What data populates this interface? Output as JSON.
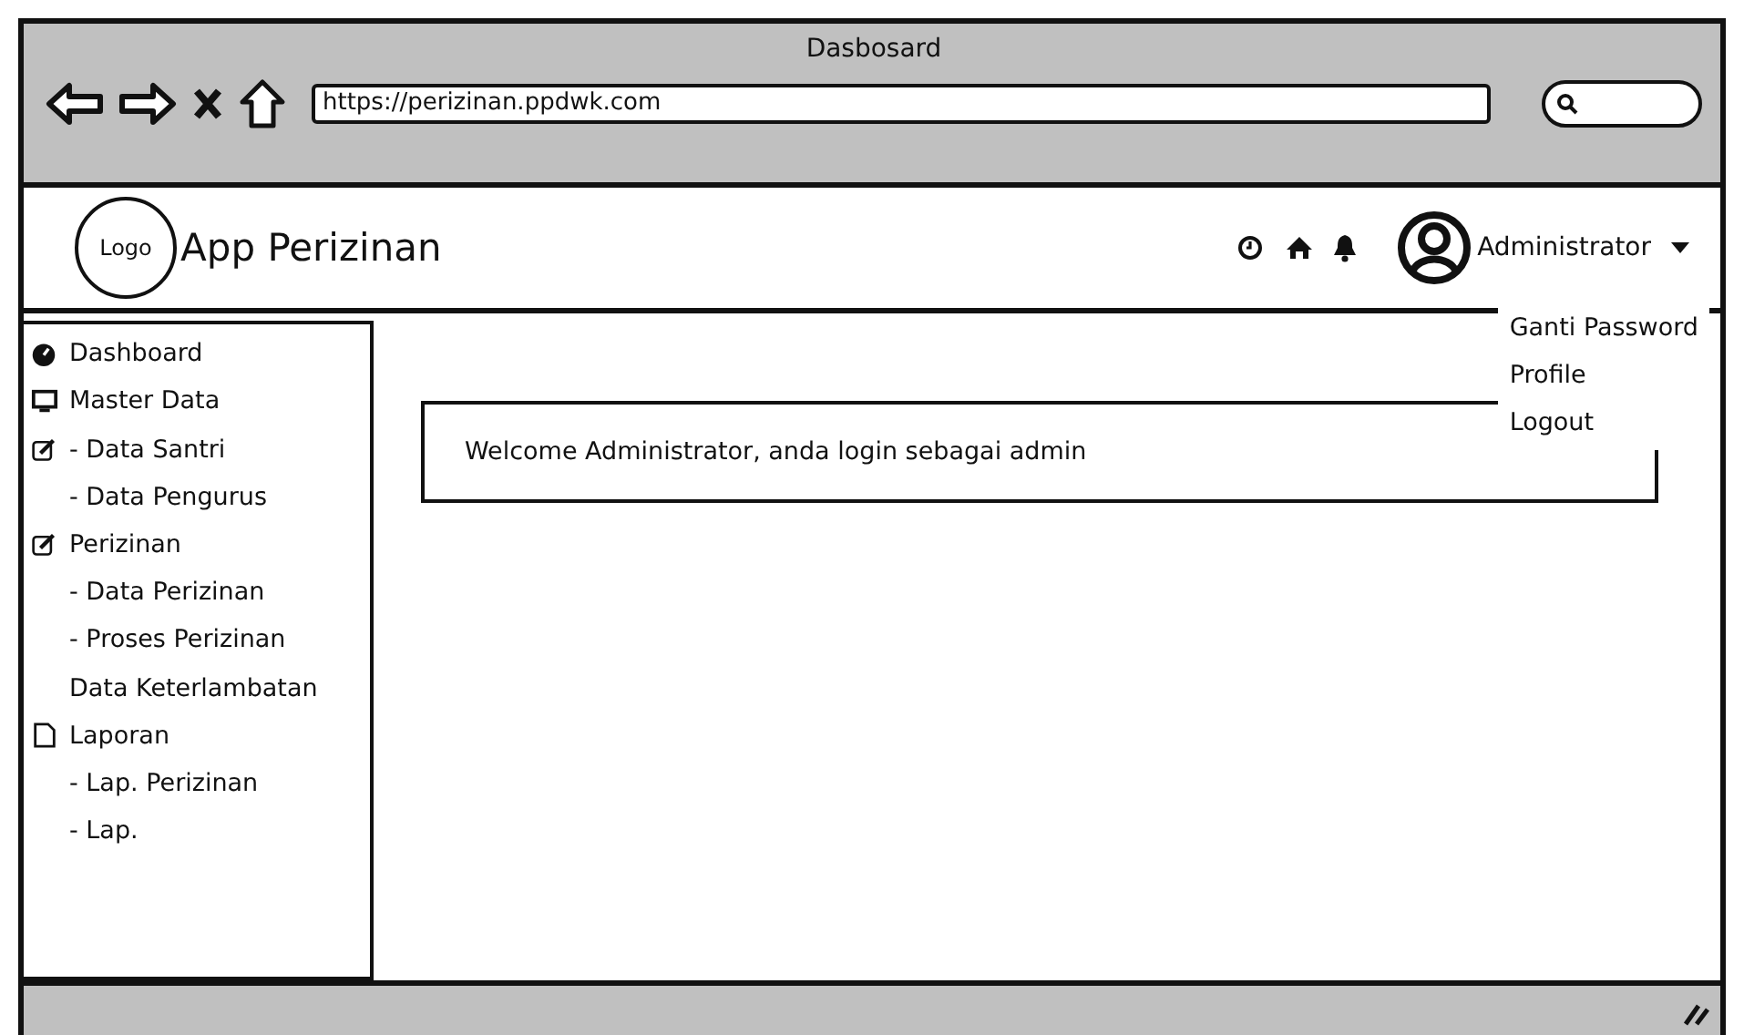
{
  "window": {
    "title": "Dasbosard"
  },
  "browser": {
    "url": "https://perizinan.ppdwk.com"
  },
  "header": {
    "logo": "Logo",
    "app_name": "App Perizinan",
    "user": "Administrator"
  },
  "user_menu": {
    "expanded": true,
    "items": [
      "Ganti Password",
      "Profile",
      "Logout"
    ]
  },
  "sidebar": {
    "items": [
      {
        "label": "Dashboard",
        "kind": "gauge"
      },
      {
        "label": "Master Data",
        "kind": "monitor"
      },
      {
        "label": "- Data Santri",
        "kind": "edit"
      },
      {
        "label": "- Data Pengurus",
        "kind": "plain"
      },
      {
        "label": "Perizinan",
        "kind": "edit"
      },
      {
        "label": "- Data Perizinan",
        "kind": "plain"
      },
      {
        "label": "- Proses Perizinan",
        "kind": "plain"
      },
      {
        "label": "Data Keterlambatan",
        "kind": "plain"
      },
      {
        "label": "Laporan",
        "kind": "file"
      },
      {
        "label": "- Lap. Perizinan",
        "kind": "plain"
      },
      {
        "label": "- Lap.",
        "kind": "plain"
      }
    ]
  },
  "content": {
    "welcome": "Welcome Administrator, anda login sebagai admin"
  }
}
